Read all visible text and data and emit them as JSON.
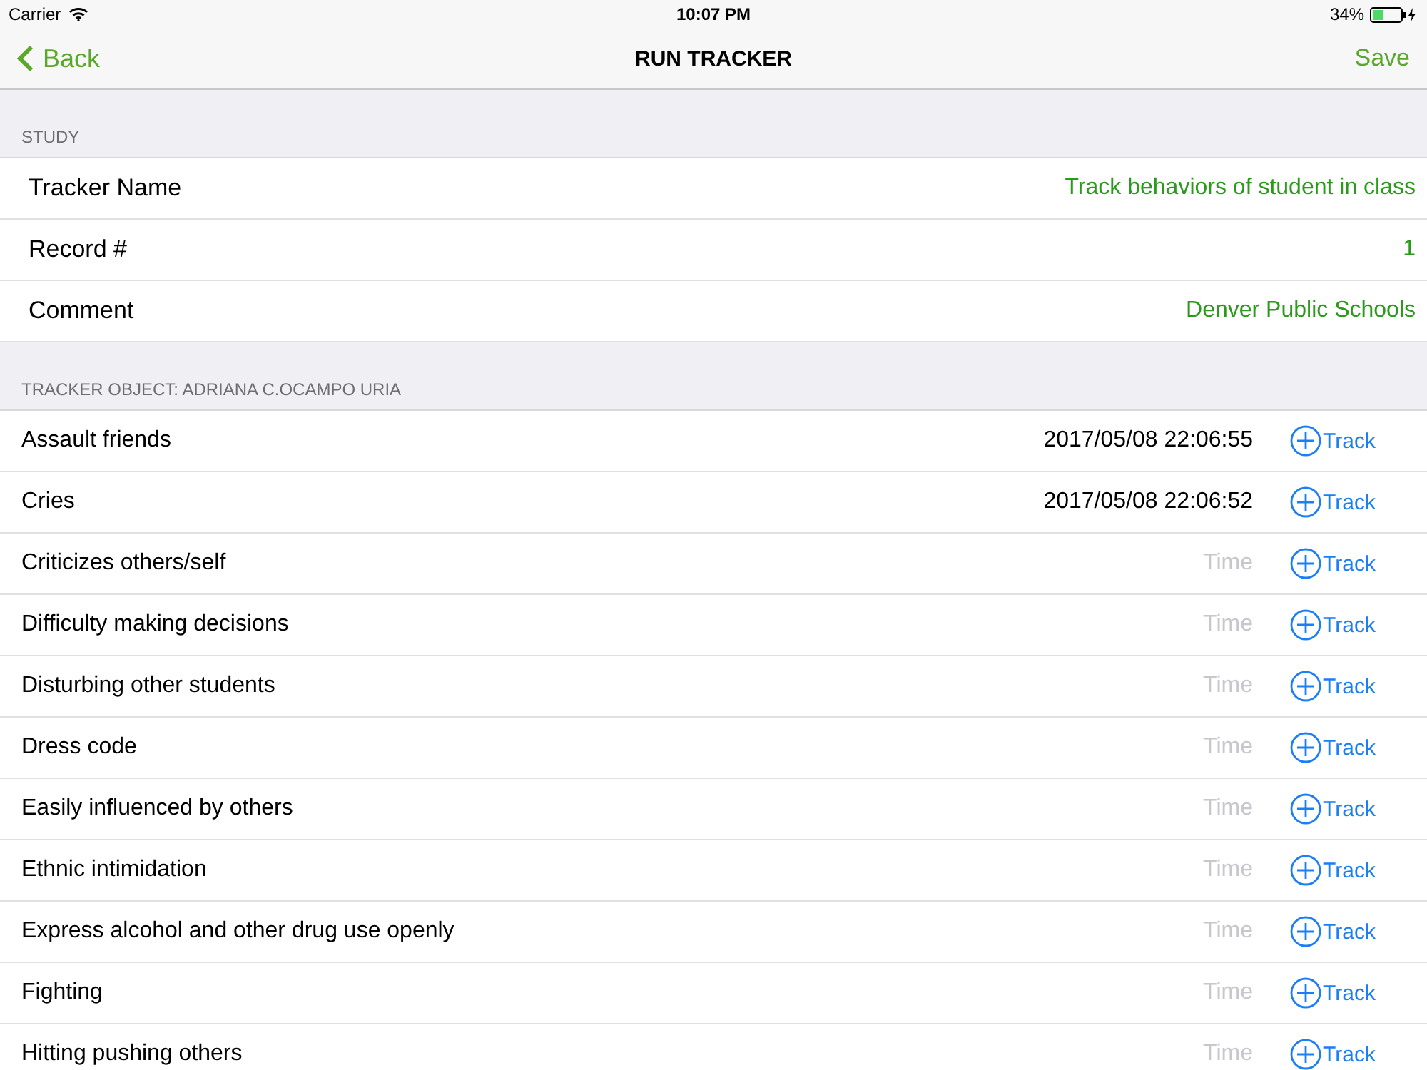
{
  "status_bar": {
    "carrier": "Carrier",
    "time": "10:07 PM",
    "battery": "34%"
  },
  "nav": {
    "back": "Back",
    "title": "RUN TRACKER",
    "save": "Save"
  },
  "study": {
    "header": "STUDY",
    "fields": [
      {
        "label": "Tracker Name",
        "value": "Track behaviors of student in class"
      },
      {
        "label": "Record #",
        "value": "1"
      },
      {
        "label": "Comment",
        "value": "Denver Public Schools"
      }
    ]
  },
  "tracker": {
    "header": "TRACKER OBJECT: ADRIANA C.OCAMPO URIA",
    "rows": [
      {
        "name": "Assault friends",
        "time": "2017/05/08 22:06:55",
        "button": "Track"
      },
      {
        "name": "Cries",
        "time": "2017/05/08 22:06:52",
        "button": "Track"
      },
      {
        "name": "Criticizes others/self",
        "placeholder": "Time",
        "button": "Track"
      },
      {
        "name": "Difficulty making decisions",
        "placeholder": "Time",
        "button": "Track"
      },
      {
        "name": "Disturbing other students",
        "placeholder": "Time",
        "button": "Track"
      },
      {
        "name": "Dress code",
        "placeholder": "Time",
        "button": "Track"
      },
      {
        "name": "Easily influenced by others",
        "placeholder": "Time",
        "button": "Track"
      },
      {
        "name": "Ethnic intimidation",
        "placeholder": "Time",
        "button": "Track"
      },
      {
        "name": "Express alcohol and other drug use openly",
        "placeholder": "Time",
        "button": "Track"
      },
      {
        "name": "Fighting",
        "placeholder": "Time",
        "button": "Track"
      },
      {
        "name": "Hitting pushing others",
        "placeholder": "Time",
        "button": "Track"
      }
    ]
  }
}
